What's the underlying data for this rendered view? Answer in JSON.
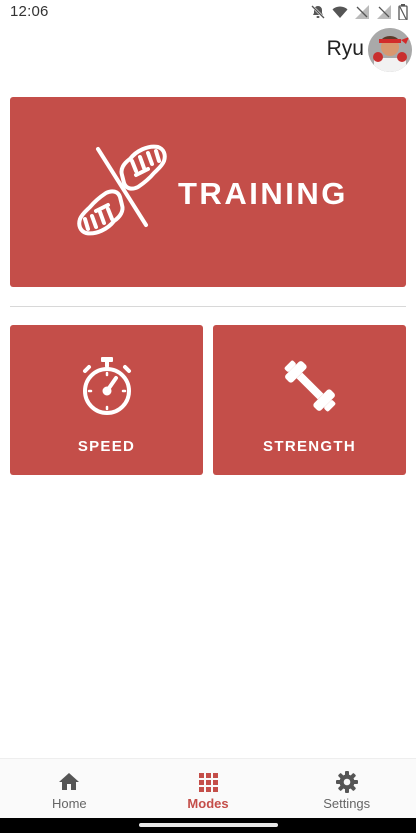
{
  "status_bar": {
    "time": "12:06",
    "icons": [
      "notifications-off-icon",
      "wifi-icon",
      "signal-icon",
      "signal-icon-2",
      "battery-icon"
    ]
  },
  "header": {
    "user_name": "Ryu",
    "avatar": "avatar-image"
  },
  "modes": {
    "training": {
      "label": "TRAINING",
      "icon": "fist-bump-icon"
    },
    "speed": {
      "label": "SPEED",
      "icon": "stopwatch-icon"
    },
    "strength": {
      "label": "STRENGTH",
      "icon": "dumbbell-icon"
    }
  },
  "bottom_nav": {
    "items": [
      {
        "label": "Home",
        "icon": "home-icon",
        "active": false
      },
      {
        "label": "Modes",
        "icon": "grid-icon",
        "active": true
      },
      {
        "label": "Settings",
        "icon": "gear-icon",
        "active": false
      }
    ]
  },
  "colors": {
    "accent": "#c44e49",
    "text": "#222222",
    "nav_inactive": "#666666"
  }
}
